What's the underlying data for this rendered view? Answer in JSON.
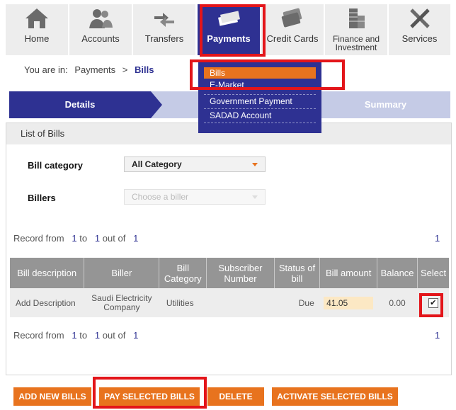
{
  "nav": {
    "tabs": [
      {
        "label": "Home",
        "icon": "home-icon"
      },
      {
        "label": "Accounts",
        "icon": "people-icon"
      },
      {
        "label": "Transfers",
        "icon": "transfer-arrows-icon"
      },
      {
        "label": "Payments",
        "icon": "cash-icon",
        "active": true
      },
      {
        "label": "Credit Cards",
        "icon": "credit-card-icon"
      },
      {
        "label": "Finance and Investment",
        "icon": "coins-icon"
      },
      {
        "label": "Services",
        "icon": "tools-icon"
      }
    ]
  },
  "breadcrumb": {
    "prefix": "You are in:",
    "parent": "Payments",
    "separator": ">",
    "current": "Bills"
  },
  "dropdown": {
    "items": [
      "Bills",
      "E-Market",
      "Government Payment",
      "SADAD Account"
    ],
    "active": "Bills"
  },
  "steps": {
    "first": "Details",
    "last": "Summary"
  },
  "panel": {
    "title": "List of Bills",
    "bill_category_label": "Bill category",
    "bill_category_value": "All Category",
    "billers_label": "Billers",
    "billers_placeholder": "Choose a biller",
    "record_top": {
      "prefix": "Record from",
      "from": "1",
      "to_word": "to",
      "to": "1",
      "outof_word": "out of",
      "total": "1"
    },
    "page_top": "1",
    "record_bottom": {
      "prefix": "Record from",
      "from": "1",
      "to_word": "to",
      "to": "1",
      "outof_word": "out of",
      "total": "1"
    },
    "page_bottom": "1"
  },
  "table": {
    "headers": [
      "Bill description",
      "Biller",
      "Bill Category",
      "Subscriber Number",
      "Status of bill",
      "Bill amount",
      "Balance",
      "Select"
    ],
    "rows": [
      {
        "description": "Add Description",
        "biller": "Saudi Electricity Company",
        "category": "Utilities",
        "subscriber": "",
        "status": "Due",
        "amount": "41.05",
        "balance": "0.00",
        "selected": true
      }
    ]
  },
  "buttons": {
    "add": "ADD NEW BILLS",
    "pay": "PAY SELECTED BILLS",
    "delete": "DELETE",
    "activate": "ACTIVATE SELECTED BILLS"
  },
  "colors": {
    "primary": "#2e3192",
    "accent": "#e8731e",
    "highlight": "#e3151a"
  }
}
